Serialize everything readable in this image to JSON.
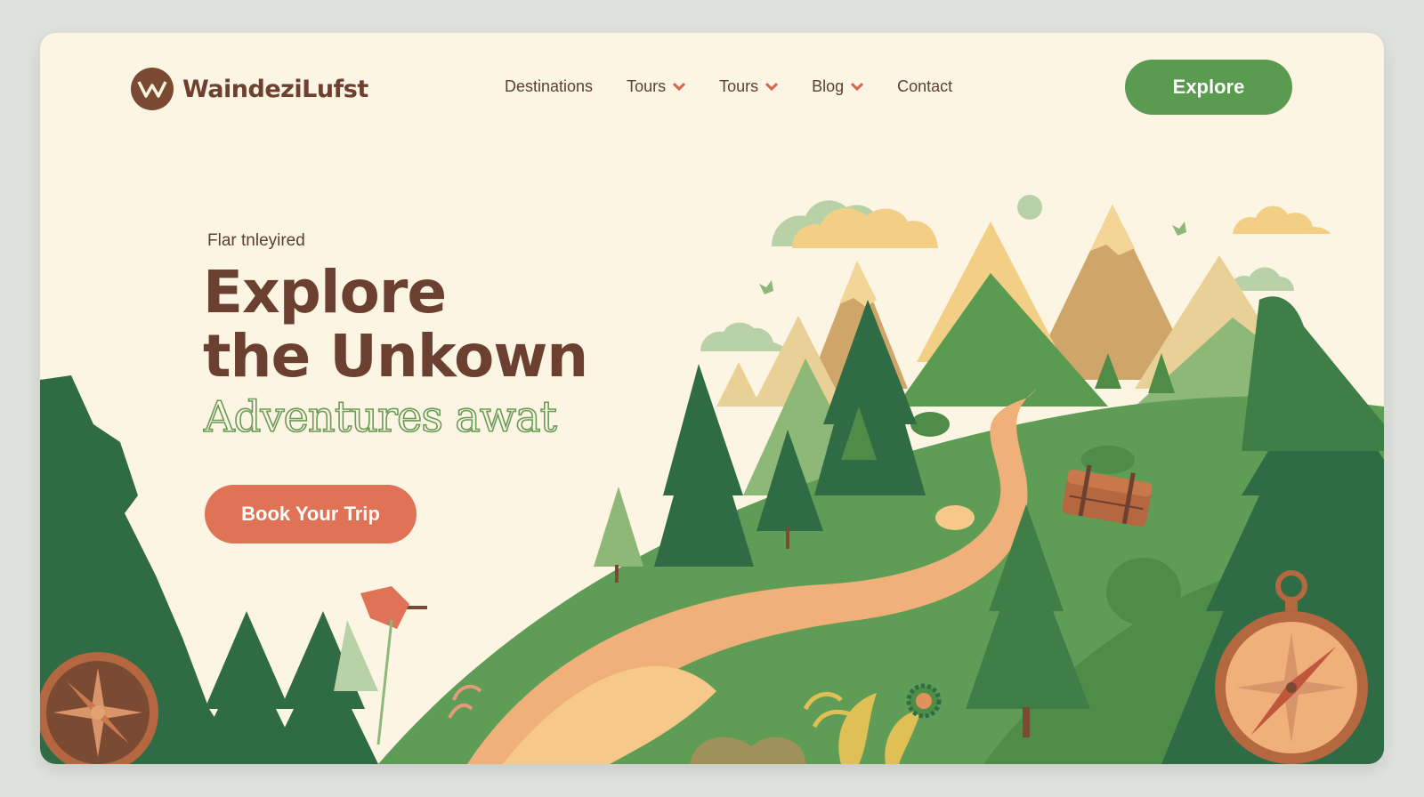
{
  "brand": {
    "name": "WaindeziLufst",
    "logo_icon": "mountain-logo-icon"
  },
  "nav": {
    "items": [
      {
        "label": "Destinations",
        "dropdown": false
      },
      {
        "label": "Tours",
        "dropdown": true
      },
      {
        "label": "Tours",
        "dropdown": true
      },
      {
        "label": "Blog",
        "dropdown": true
      },
      {
        "label": "Contact",
        "dropdown": false
      }
    ],
    "caret_icon": "chevron-down-icon"
  },
  "header_cta": {
    "label": "Explore"
  },
  "hero": {
    "eyebrow": "Flar tnleyired",
    "headline_line1": "Explore",
    "headline_line2": "the Unkown",
    "tagline": "Adventures awat",
    "button_label": "Book Your Trip"
  },
  "colors": {
    "background": "#fcf5e4",
    "brand_brown": "#6b4030",
    "accent_green": "#5a9a51",
    "accent_coral": "#e07256",
    "forest_dark": "#2f6b45"
  },
  "illustration": {
    "icons": [
      "compass-icon",
      "leather-bag-icon",
      "compass-rose-icon",
      "flag-icon"
    ]
  }
}
